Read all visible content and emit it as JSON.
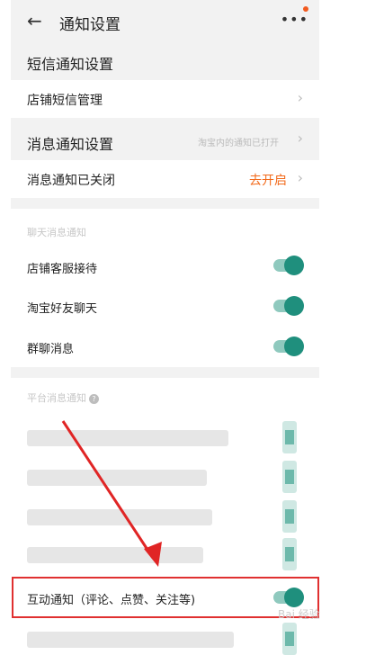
{
  "header": {
    "back_icon": "←",
    "title": "通知设置",
    "more_icon": "•••"
  },
  "sms_section": {
    "title": "短信通知设置",
    "shop_sms_label": "店铺短信管理"
  },
  "message_section": {
    "title": "消息通知设置",
    "hint": "淘宝内的通知已打开",
    "closed_label": "消息通知已关闭",
    "open_action": "去开启"
  },
  "chat_card": {
    "head": "聊天消息通知",
    "items": [
      {
        "label": "店铺客服接待",
        "on": true
      },
      {
        "label": "淘宝好友聊天",
        "on": true
      },
      {
        "label": "群聊消息",
        "on": true
      }
    ]
  },
  "platform_card": {
    "head": "平台消息通知",
    "question_icon": "?",
    "highlighted_item": {
      "label": "互动通知（评论、点赞、关注等)",
      "on": true
    }
  },
  "watermark": {
    "text": "Bai 经验"
  }
}
